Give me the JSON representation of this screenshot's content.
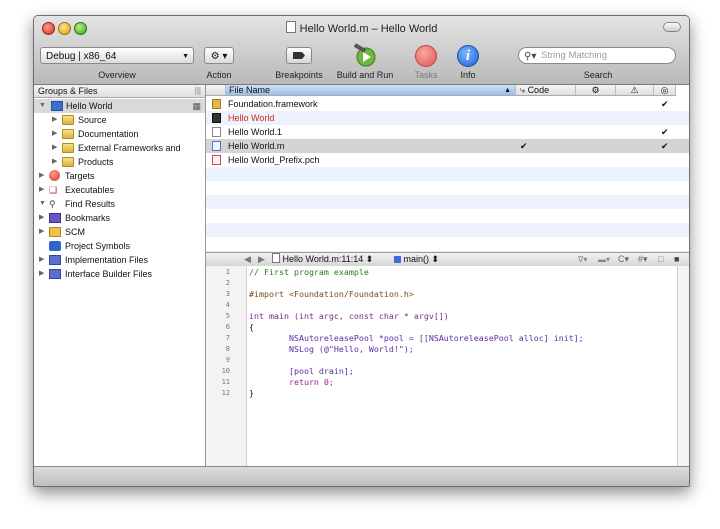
{
  "window": {
    "title": "Hello World.m – Hello World"
  },
  "toolbar": {
    "overview_value": "Debug | x86_64",
    "overview_label": "Overview",
    "action_value": "⚙ ▾",
    "action_label": "Action",
    "breakpoints_label": "Breakpoints",
    "build_run_label": "Build and Run",
    "tasks_label": "Tasks",
    "info_label": "Info",
    "search_placeholder": "String Matching",
    "search_label": "Search"
  },
  "sidebar": {
    "header": "Groups & Files",
    "items": [
      {
        "label": "Hello World"
      },
      {
        "label": "Source"
      },
      {
        "label": "Documentation"
      },
      {
        "label": "External Frameworks and"
      },
      {
        "label": "Products"
      },
      {
        "label": "Targets"
      },
      {
        "label": "Executables"
      },
      {
        "label": "Find Results"
      },
      {
        "label": "Bookmarks"
      },
      {
        "label": "SCM"
      },
      {
        "label": "Project Symbols"
      },
      {
        "label": "Implementation Files"
      },
      {
        "label": "Interface Builder Files"
      }
    ]
  },
  "file_table": {
    "columns": [
      "File Name",
      "Code"
    ],
    "rows": [
      {
        "name": "Foundation.framework",
        "code": "",
        "checked": "✔"
      },
      {
        "name": "Hello World",
        "code": "",
        "checked": ""
      },
      {
        "name": "Hello World.1",
        "code": "",
        "checked": "✔"
      },
      {
        "name": "Hello World.m",
        "code": "✔",
        "checked": "✔"
      },
      {
        "name": "Hello World_Prefix.pch",
        "code": "",
        "checked": ""
      }
    ]
  },
  "editor": {
    "file_popup": "Hello World.m:11:14 ⬍",
    "symbol_popup": "main() ⬍",
    "line_numbers": [
      "1",
      "2",
      "3",
      "4",
      "5",
      "6",
      "7",
      "8",
      "9",
      "10",
      "11",
      "12"
    ],
    "lines": [
      "// First program example",
      "",
      "#import <Foundation/Foundation.h>",
      "",
      "int main (int argc, const char * argv[])",
      "{",
      "        NSAutoreleasePool *pool = [[NSAutoreleasePool alloc] init];",
      "        NSLog (@\"Hello, World!\");",
      "",
      "        [pool drain];",
      "        return 0;",
      "}"
    ]
  },
  "colors": {
    "link_red": "#d4281c",
    "comment": "#2a7a1e",
    "keyword": "#a0208a",
    "string": "#c41a16",
    "type": "#5b2ea6"
  }
}
